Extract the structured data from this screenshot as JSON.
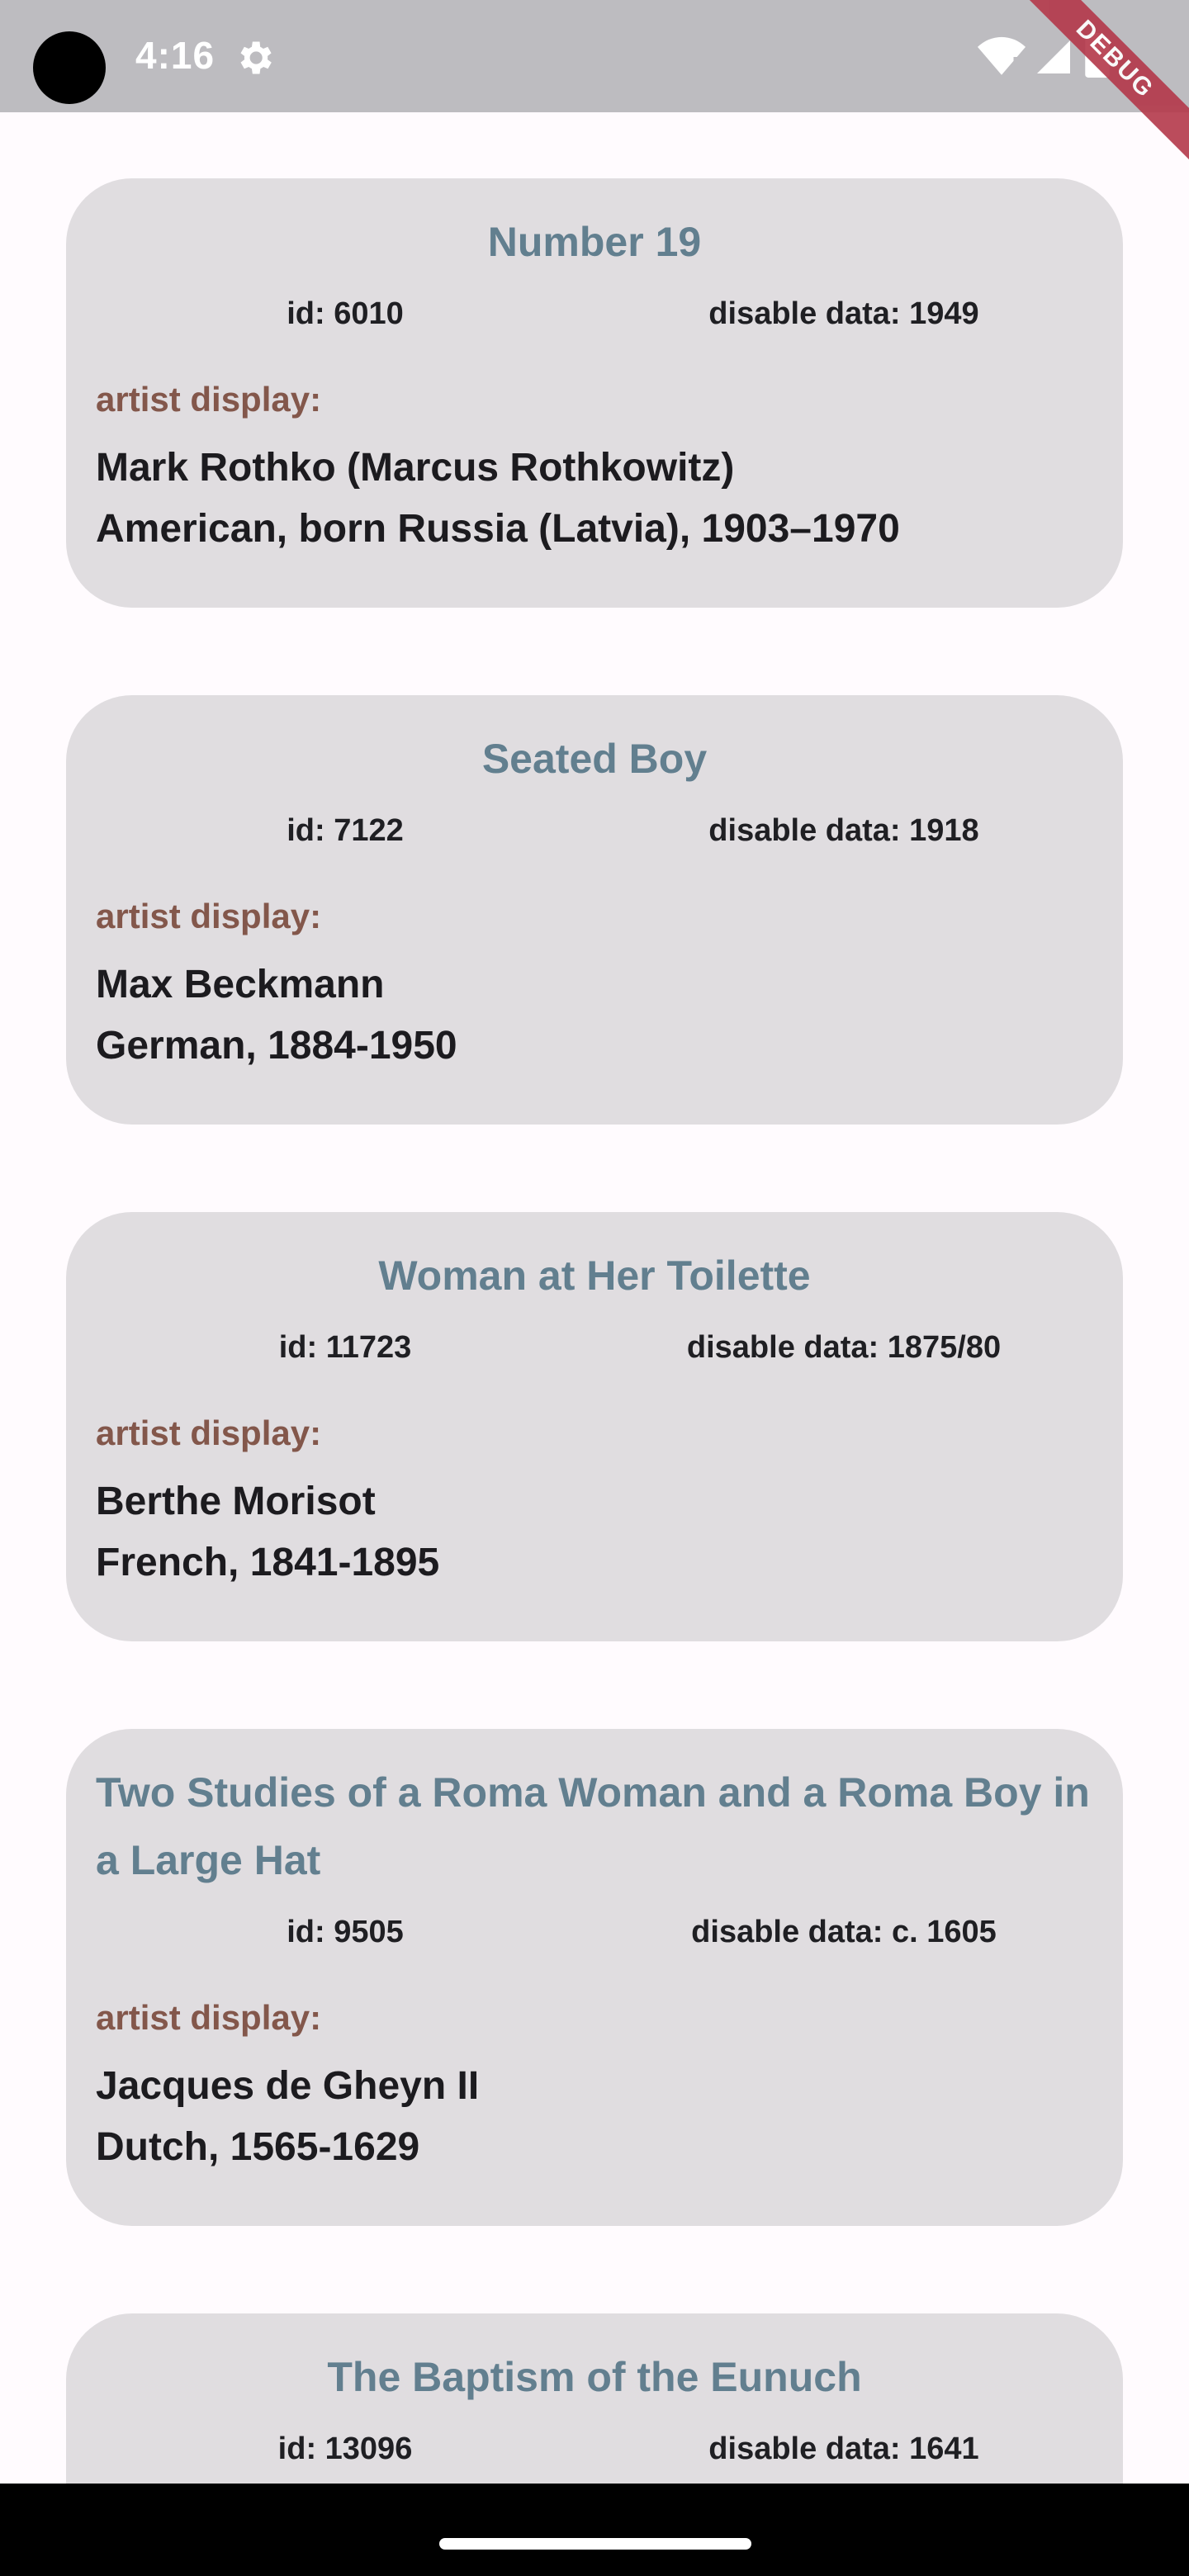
{
  "status_bar": {
    "time": "4:16",
    "icons": [
      "settings-icon",
      "wifi-icon",
      "signal-icon",
      "battery-icon"
    ],
    "debug_banner": "DEBUG"
  },
  "artworks": [
    {
      "title": "Number 19",
      "id_text": "id: 6010",
      "date_text": "disable data: 1949",
      "artist_label": "artist display:",
      "artist_display": "Mark Rothko (Marcus Rothkowitz)\nAmerican, born Russia (Latvia), 1903–1970"
    },
    {
      "title": "Seated Boy",
      "id_text": "id: 7122",
      "date_text": "disable data: 1918",
      "artist_label": "artist display:",
      "artist_display": "Max Beckmann\nGerman, 1884-1950"
    },
    {
      "title": "Woman at Her Toilette",
      "id_text": "id: 11723",
      "date_text": "disable data: 1875/80",
      "artist_label": "artist display:",
      "artist_display": "Berthe Morisot\nFrench, 1841-1895"
    },
    {
      "title": "Two Studies of a Roma Woman and a Roma Boy in a Large Hat",
      "id_text": "id: 9505",
      "date_text": "disable data: c. 1605",
      "artist_label": "artist display:",
      "artist_display": "Jacques de Gheyn II\nDutch, 1565-1629"
    },
    {
      "title": "The Baptism of the Eunuch",
      "id_text": "id: 13096",
      "date_text": "disable data: 1641"
    }
  ],
  "colors": {
    "card_background": "#e0dde0",
    "title": "#627f8f",
    "artist_label": "#83574b",
    "text": "#1c1b1f",
    "page_background": "#fffbfe"
  }
}
